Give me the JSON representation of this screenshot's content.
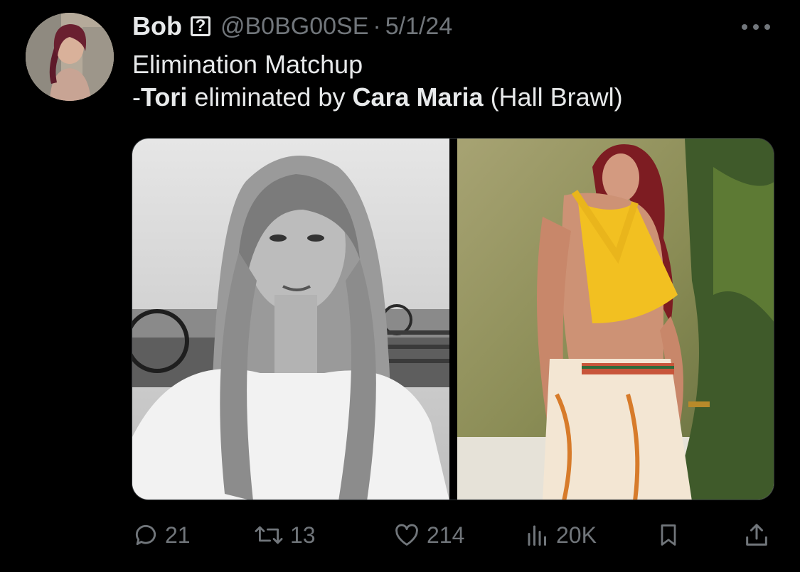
{
  "tweet": {
    "author_name": "Bob",
    "badge_symbol": "?",
    "handle": "@B0BG00SE",
    "separator": "·",
    "date": "5/1/24",
    "line1": "Elimination Matchup",
    "line2_prefix": "-",
    "eliminated": "Tori",
    "middle": " eliminated by ",
    "eliminator": "Cara Maria",
    "suffix": " (Hall Brawl)"
  },
  "media": {
    "left_photo": "black-and-white portrait",
    "right_photo": "color portrait outdoors"
  },
  "actions": {
    "replies": "21",
    "reposts": "13",
    "likes": "214",
    "views": "20K"
  },
  "icons": {
    "more": "more-horizontal-icon",
    "reply": "reply-icon",
    "repost": "repost-icon",
    "like": "heart-icon",
    "views": "views-icon",
    "bookmark": "bookmark-icon",
    "share": "share-icon"
  },
  "colors": {
    "background": "#000000",
    "text": "#e7e9ea",
    "secondary": "#71767b"
  }
}
